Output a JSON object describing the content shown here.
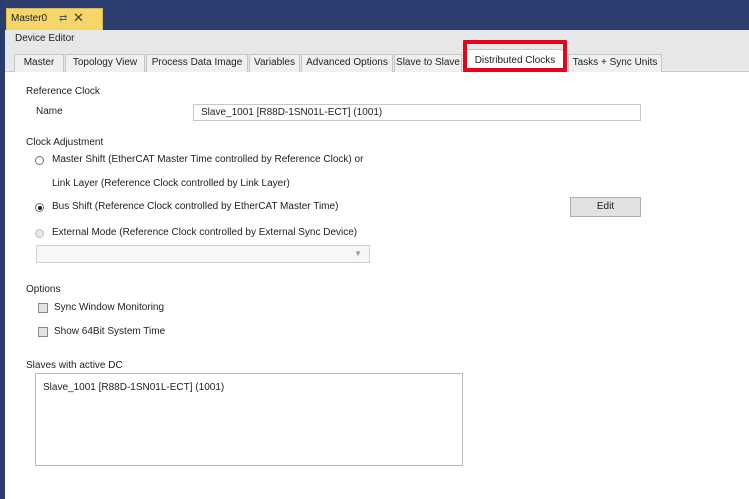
{
  "document_tab": {
    "label": "Master0",
    "pin_icon": "pin-icon",
    "close_icon": "close-icon"
  },
  "editor": {
    "title": "Device Editor"
  },
  "tabs": [
    {
      "label": "Master"
    },
    {
      "label": "Topology View"
    },
    {
      "label": "Process Data Image"
    },
    {
      "label": "Variables"
    },
    {
      "label": "Advanced Options"
    },
    {
      "label": "Slave to Slave"
    },
    {
      "label": "Distributed Clocks",
      "active": true
    },
    {
      "label": "Tasks + Sync Units"
    }
  ],
  "reference_clock": {
    "heading": "Reference Clock",
    "name_label": "Name",
    "name_value": "Slave_1001 [R88D-1SN01L-ECT] (1001)"
  },
  "clock_adjustment": {
    "heading": "Clock Adjustment",
    "option_master_shift": "Master Shift (EtherCAT Master Time controlled by Reference Clock) or",
    "option_master_shift_cont": "Link Layer (Reference Clock controlled by Link Layer)",
    "option_bus_shift": "Bus Shift (Reference Clock controlled by EtherCAT Master Time)",
    "option_external": "External Mode (Reference Clock controlled by External Sync Device)",
    "selected": "bus_shift",
    "edit_label": "Edit",
    "external_select_value": ""
  },
  "options": {
    "heading": "Options",
    "sync_window_monitoring": "Sync Window Monitoring",
    "show_64bit_time": "Show 64Bit System Time"
  },
  "slaves_with_dc": {
    "heading": "Slaves with active DC",
    "items": [
      "Slave_1001 [R88D-1SN01L-ECT] (1001)"
    ]
  },
  "colors": {
    "title_bar": "#2d3f6e",
    "doc_tab": "#f5d66b",
    "highlight": "#e8001c"
  }
}
